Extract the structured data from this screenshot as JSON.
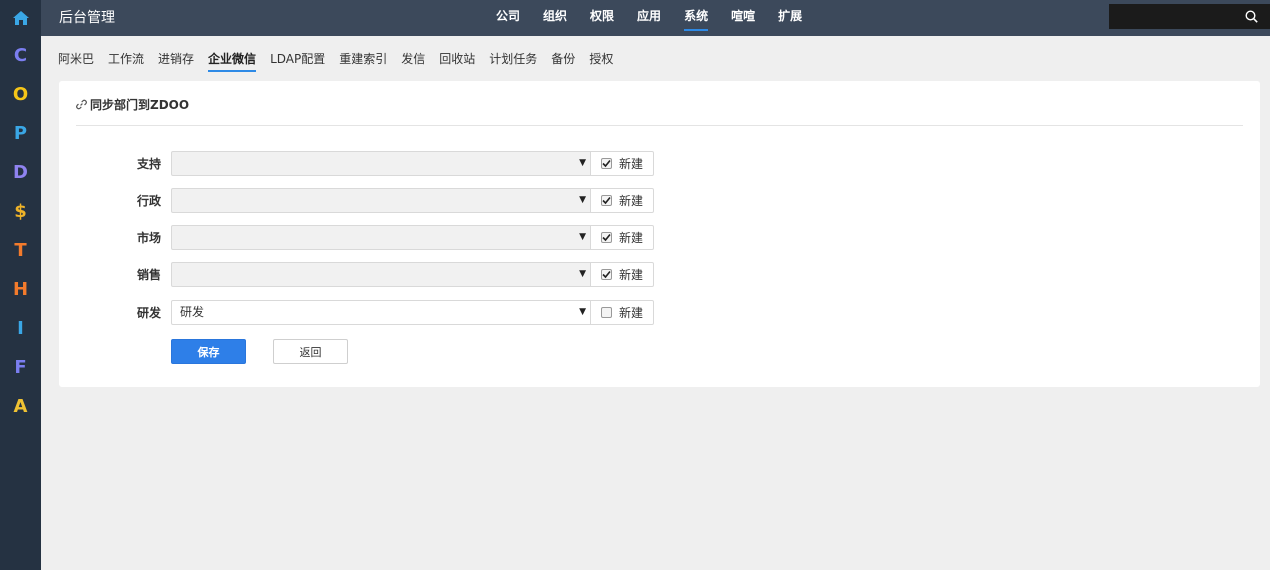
{
  "header": {
    "brand": "后台管理",
    "menu": [
      {
        "label": "公司"
      },
      {
        "label": "组织"
      },
      {
        "label": "权限"
      },
      {
        "label": "应用"
      },
      {
        "label": "系统"
      },
      {
        "label": "喧喧"
      },
      {
        "label": "扩展"
      }
    ],
    "active_menu": "系统",
    "search": {
      "value": "",
      "placeholder": ""
    }
  },
  "leftnav": {
    "items": [
      {
        "letter": "C",
        "color": "#7b7ef0"
      },
      {
        "letter": "O",
        "color": "#f5c518"
      },
      {
        "letter": "P",
        "color": "#3aa7e6"
      },
      {
        "letter": "D",
        "color": "#8f83f0"
      },
      {
        "letter": "$",
        "color": "#f0b429"
      },
      {
        "letter": "T",
        "color": "#f37b2c"
      },
      {
        "letter": "H",
        "color": "#f37b2c"
      },
      {
        "letter": "I",
        "color": "#3aa7e6"
      },
      {
        "letter": "F",
        "color": "#7b7ef0"
      },
      {
        "letter": "A",
        "color": "#f0c233"
      }
    ],
    "home_color": "#3aa7e6"
  },
  "subnav": {
    "items": [
      {
        "label": "阿米巴"
      },
      {
        "label": "工作流"
      },
      {
        "label": "进销存"
      },
      {
        "label": "企业微信"
      },
      {
        "label": "LDAP配置"
      },
      {
        "label": "重建索引"
      },
      {
        "label": "发信"
      },
      {
        "label": "回收站"
      },
      {
        "label": "计划任务"
      },
      {
        "label": "备份"
      },
      {
        "label": "授权"
      }
    ],
    "active": "企业微信"
  },
  "panel": {
    "title": "同步部门到ZDOO",
    "rows": [
      {
        "label": "支持",
        "value": "",
        "checkbox_label": "新建",
        "checked": true
      },
      {
        "label": "行政",
        "value": "",
        "checkbox_label": "新建",
        "checked": true
      },
      {
        "label": "市场",
        "value": "",
        "checkbox_label": "新建",
        "checked": true
      },
      {
        "label": "销售",
        "value": "",
        "checkbox_label": "新建",
        "checked": true
      },
      {
        "label": "研发",
        "value": "研发",
        "checkbox_label": "新建",
        "checked": false
      }
    ],
    "save_label": "保存",
    "back_label": "返回"
  },
  "colors": {
    "header_bg": "#3c495b",
    "leftnav_bg": "#253242",
    "accent": "#2e7fe8"
  }
}
